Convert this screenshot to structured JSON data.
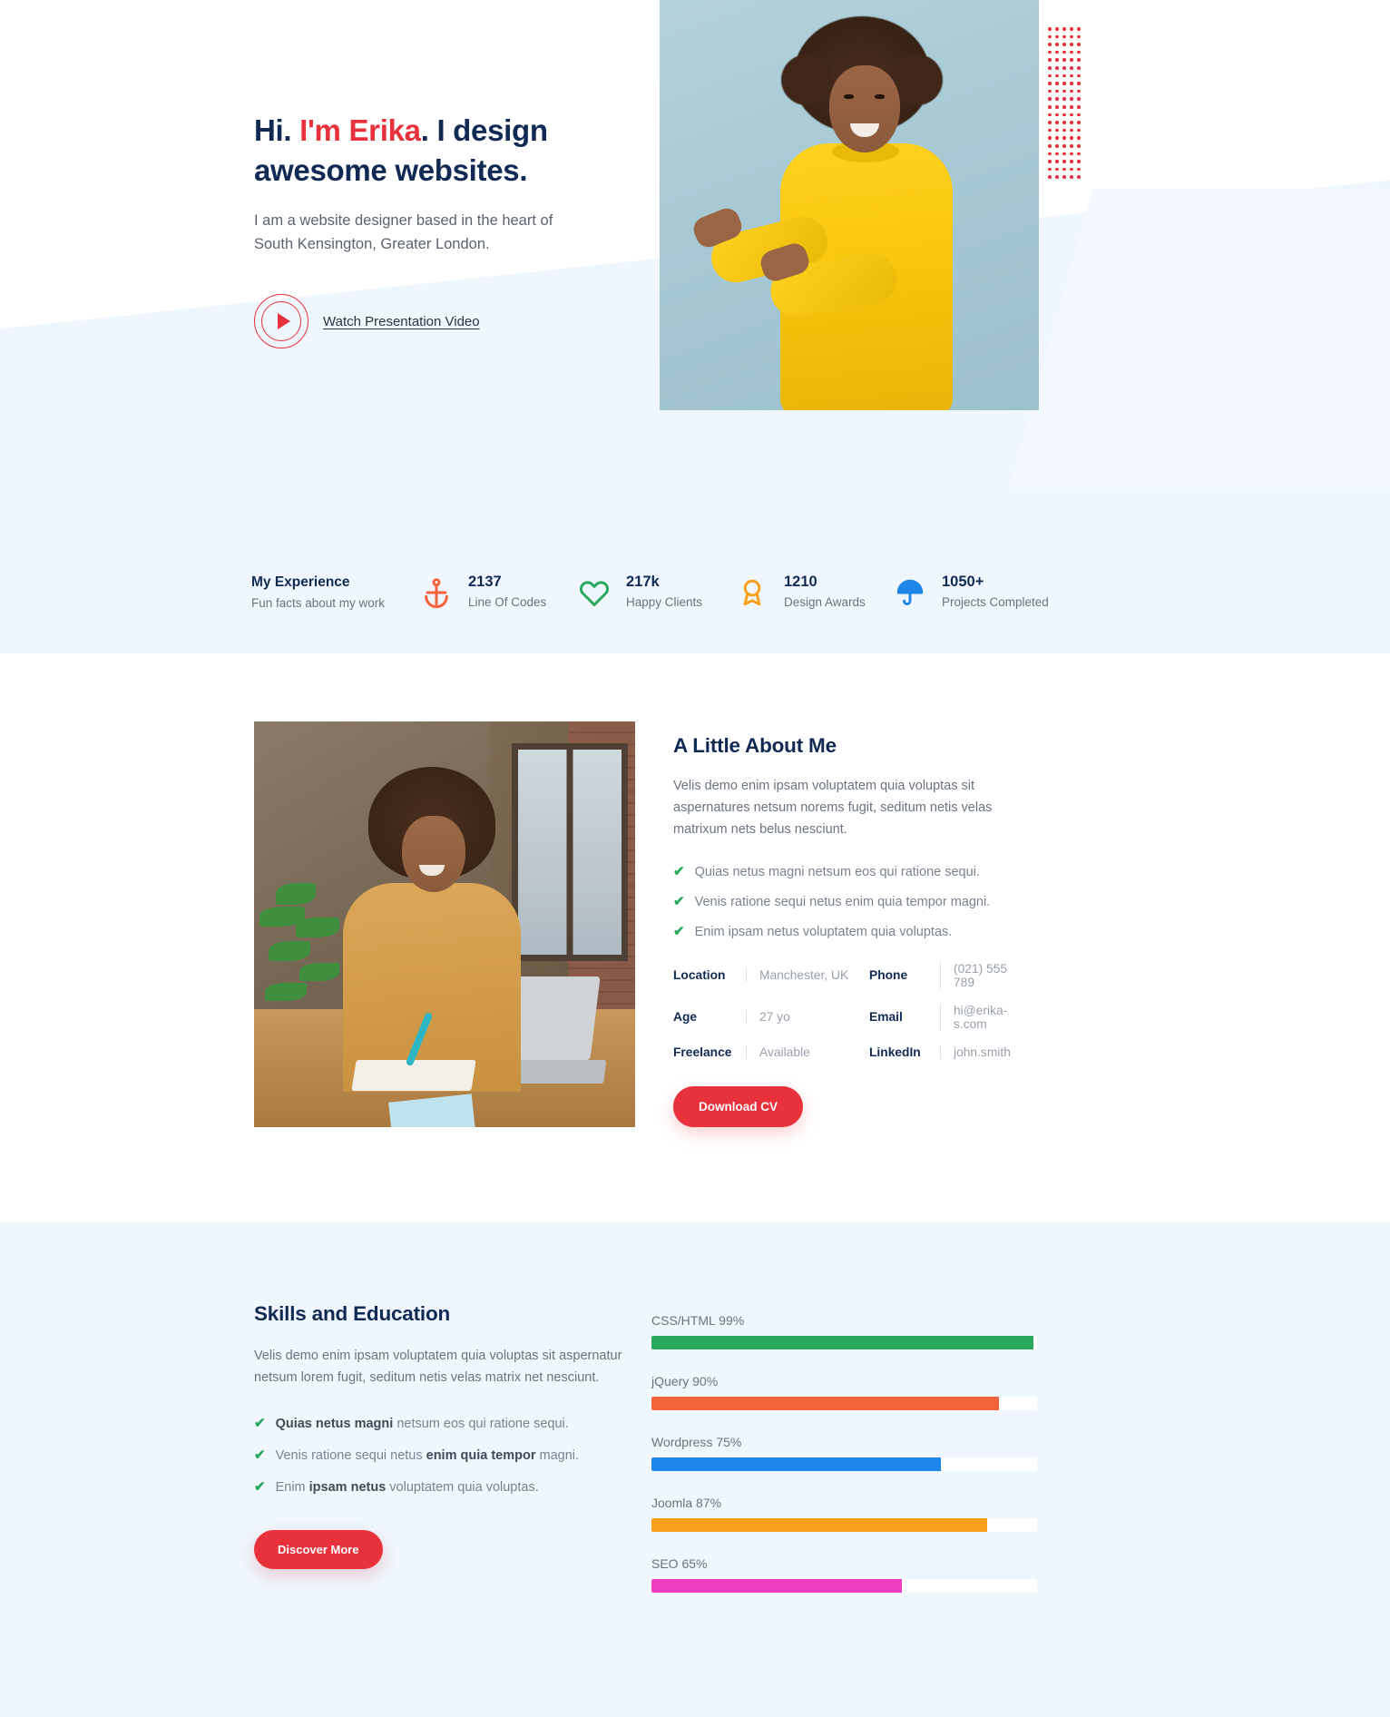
{
  "hero": {
    "title_part1": "Hi. ",
    "title_accent": "I'm Erika",
    "title_part2": ". I design awesome websites.",
    "subtitle": "I am a website designer based in the heart of South Kensington, Greater London.",
    "watch_label": "Watch Presentation Video",
    "play_icon": "play-icon",
    "accent_color": "#e8313b",
    "heading_color": "#102a54"
  },
  "stats": {
    "lead_title": "My Experience",
    "lead_subtitle": "Fun facts about my work",
    "items": [
      {
        "icon": "anchor-icon",
        "value": "2137",
        "label": "Line Of Codes",
        "color": "#f4623a"
      },
      {
        "icon": "heart-icon",
        "value": "217k",
        "label": "Happy Clients",
        "color": "#27a85a"
      },
      {
        "icon": "award-icon",
        "value": "1210",
        "label": "Design Awards",
        "color": "#f8a01b"
      },
      {
        "icon": "umbrella-icon",
        "value": "1050+",
        "label": "Projects Completed",
        "color": "#1e86e8"
      }
    ]
  },
  "about": {
    "title": "A Little About Me",
    "paragraph": "Velis demo enim ipsam voluptatem quia voluptas sit aspernatures netsum norems fugit, seditum netis velas matrixum nets belus nesciunt.",
    "bullets": [
      "Quias netus magni netsum eos qui ratione sequi.",
      "Venis ratione sequi netus enim quia tempor magni.",
      "Enim ipsam netus voluptatem quia voluptas."
    ],
    "info": [
      {
        "key": "Location",
        "value": "Manchester, UK"
      },
      {
        "key": "Phone",
        "value": "(021) 555 789"
      },
      {
        "key": "Age",
        "value": "27 yo"
      },
      {
        "key": "Email",
        "value": "hi@erika-s.com"
      },
      {
        "key": "Freelance",
        "value": "Available"
      },
      {
        "key": "LinkedIn",
        "value": "john.smith"
      }
    ],
    "cv_button": "Download CV"
  },
  "skills": {
    "title": "Skills and Education",
    "paragraph": "Velis demo enim ipsam voluptatem quia voluptas sit aspernatur netsum lorem fugit, seditum netis velas matrix net nesciunt.",
    "bullets": [
      {
        "bold": "Quias netus magni",
        "rest": " netsum eos qui ratione sequi.",
        "lead_bold": true
      },
      {
        "pre": "Venis ratione sequi netus ",
        "bold": "enim quia tempor",
        "rest": " magni.",
        "lead_bold": false
      },
      {
        "pre": "Enim ",
        "bold": "ipsam netus",
        "rest": " voluptatem quia voluptas.",
        "lead_bold": false
      }
    ],
    "discover_button": "Discover More",
    "chart_data": {
      "type": "bar",
      "orientation": "horizontal",
      "title": "Skills and Education",
      "categories": [
        "CSS/HTML",
        "jQuery",
        "Wordpress",
        "Joomla",
        "SEO"
      ],
      "values": [
        99,
        90,
        75,
        87,
        65
      ],
      "labels": [
        "CSS/HTML 99%",
        "jQuery 90%",
        "Wordpress 75%",
        "Joomla 87%",
        "SEO 65%"
      ],
      "colors": [
        "#27a85a",
        "#f4623a",
        "#1e86e8",
        "#f8a01b",
        "#f03ec0"
      ],
      "track_color": "#ffffff",
      "xlim": [
        0,
        100
      ],
      "xlabel": "",
      "ylabel": "",
      "grid": false,
      "legend": false
    }
  }
}
